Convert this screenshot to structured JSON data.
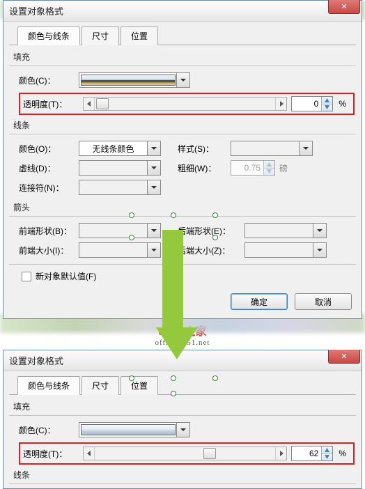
{
  "window_title": "设置对象格式",
  "close_glyph": "✕",
  "tabs": {
    "t0": "颜色与线条",
    "t1": "尺寸",
    "t2": "位置"
  },
  "fill": {
    "section": "填充",
    "color_label": "颜色(C)：",
    "trans_label": "透明度(T)：",
    "value_top": "0",
    "value_bottom": "62",
    "pct": "%"
  },
  "line": {
    "section": "线条",
    "color_label": "颜色(O)：",
    "color_value": "无线条颜色",
    "style_label": "样式(S)：",
    "dash_label": "虚线(D)：",
    "weight_label": "粗细(W)：",
    "weight_value": "0.75",
    "weight_unit": "磅",
    "conn_label": "连接符(N)："
  },
  "arrows": {
    "section": "箭头",
    "bshape": "前端形状(B)：",
    "eshape": "后端形状(E)：",
    "bsize": "前端大小(I)：",
    "esize": "后端大小(Z)："
  },
  "defaults_label": "新对象默认值(F)",
  "ok": "确定",
  "cancel": "取消",
  "watermark": "office之家",
  "watermark_sub": "office.jb51.net"
}
